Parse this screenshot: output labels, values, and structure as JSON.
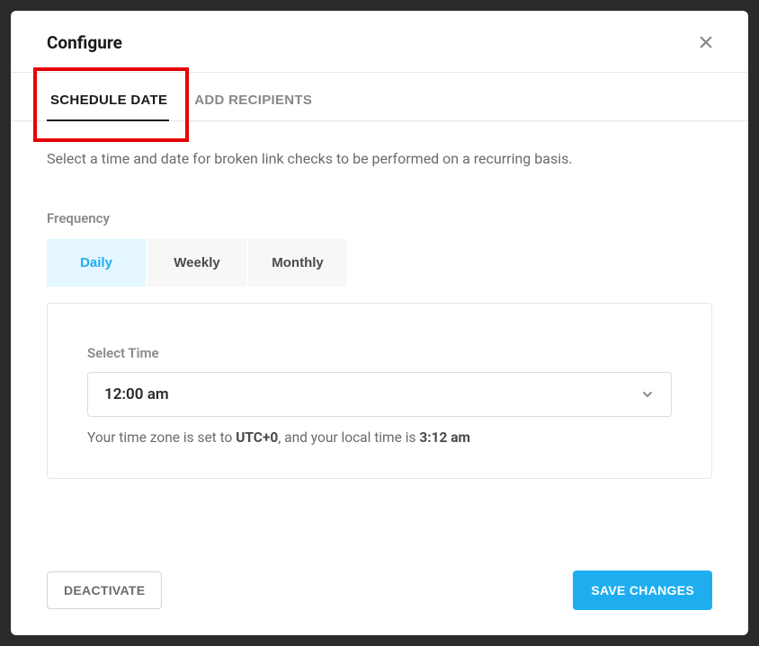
{
  "header": {
    "title": "Configure"
  },
  "tabs": {
    "schedule": "SCHEDULE DATE",
    "recipients": "ADD RECIPIENTS"
  },
  "main": {
    "description": "Select a time and date for broken link checks to be performed on a recurring basis.",
    "frequency_label": "Frequency",
    "frequency_options": {
      "daily": "Daily",
      "weekly": "Weekly",
      "monthly": "Monthly"
    },
    "time_label": "Select Time",
    "time_value": "12:00 am",
    "tz_prefix": "Your time zone is set to ",
    "tz_value": "UTC+0",
    "tz_middle": ", and your local time is ",
    "local_time": "3:12 am"
  },
  "footer": {
    "deactivate": "DEACTIVATE",
    "save": "SAVE CHANGES"
  }
}
